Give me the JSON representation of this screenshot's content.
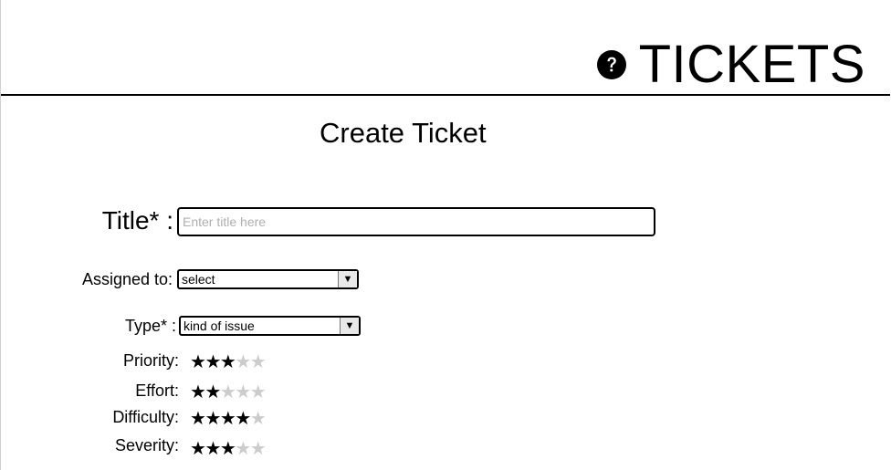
{
  "header": {
    "title": "TICKETS",
    "help_icon": "question-circle-icon"
  },
  "page": {
    "heading": "Create Ticket"
  },
  "form": {
    "title_label": "Title* :",
    "title_placeholder": "Enter title here",
    "title_value": "",
    "assigned_label": "Assigned to:",
    "assigned_value": "select",
    "type_label": "Type* :",
    "type_value": "kind of issue",
    "ratings": [
      {
        "key": "priority",
        "label": "Priority:",
        "value": 3,
        "max": 5
      },
      {
        "key": "effort",
        "label": "Effort:",
        "value": 2,
        "max": 5
      },
      {
        "key": "difficulty",
        "label": "Difficulty:",
        "value": 4,
        "max": 5
      },
      {
        "key": "severity",
        "label": "Severity:",
        "value": 3,
        "max": 5
      }
    ]
  },
  "colors": {
    "star_on": "#000000",
    "star_off": "#cccccc",
    "border": "#000000"
  }
}
